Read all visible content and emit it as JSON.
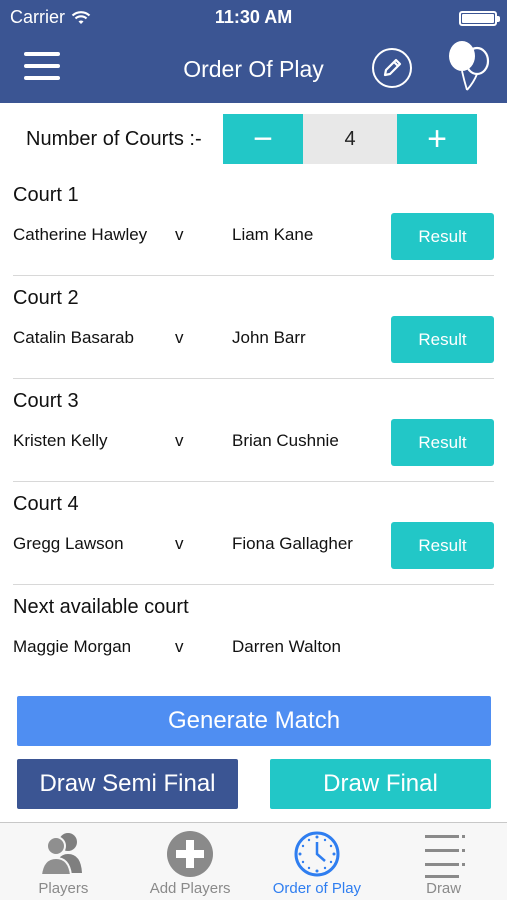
{
  "status_bar": {
    "carrier": "Carrier",
    "time": "11:30 AM"
  },
  "header": {
    "title": "Order Of Play"
  },
  "courts_control": {
    "label": "Number of Courts :-",
    "value": "4",
    "minus": "−",
    "plus": "+"
  },
  "courts": [
    {
      "title": "Court 1",
      "player1": "Catherine Hawley",
      "vs": "v",
      "player2": "Liam Kane",
      "action": "Result"
    },
    {
      "title": "Court 2",
      "player1": "Catalin Basarab",
      "vs": "v",
      "player2": "John Barr",
      "action": "Result"
    },
    {
      "title": "Court 3",
      "player1": "Kristen Kelly",
      "vs": "v",
      "player2": "Brian Cushnie",
      "action": "Result"
    },
    {
      "title": "Court 4",
      "player1": "Gregg Lawson",
      "vs": "v",
      "player2": "Fiona Gallagher",
      "action": "Result"
    }
  ],
  "next_court": {
    "title": "Next available court",
    "player1": "Maggie Morgan",
    "vs": "v",
    "player2": "Darren Walton"
  },
  "actions": {
    "generate": "Generate Match",
    "semi_final": "Draw Semi Final",
    "final": "Draw Final"
  },
  "tabs": [
    {
      "label": "Players",
      "icon": "players-icon"
    },
    {
      "label": "Add Players",
      "icon": "add-icon"
    },
    {
      "label": "Order of Play",
      "icon": "clock-icon"
    },
    {
      "label": "Draw",
      "icon": "list-icon"
    }
  ],
  "colors": {
    "header": "#3b5593",
    "teal": "#22c7c7",
    "blue": "#4f8ef2",
    "active_tab": "#2f7ef0"
  }
}
